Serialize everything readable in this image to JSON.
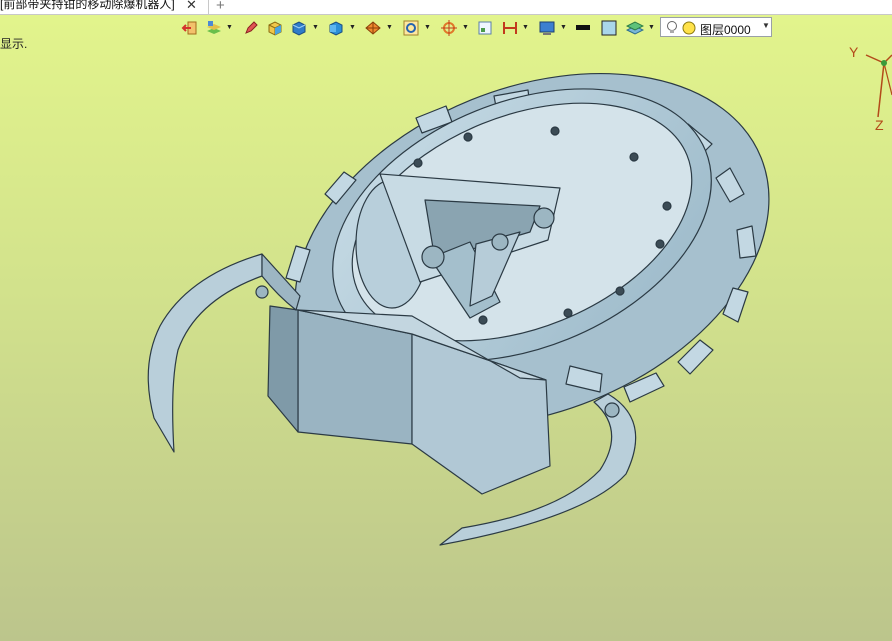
{
  "tab": {
    "title": "[前部带夹持钳的移动除爆机器人]",
    "close_glyph": "✕",
    "add_glyph": "+"
  },
  "hint": "显示.",
  "layer": {
    "value": "图层0000"
  },
  "axes": {
    "y": "Y",
    "z": "Z"
  },
  "toolbar": {
    "icons": [
      "exit-icon",
      "layers-stack-icon",
      "pencil-icon",
      "box-color-icon",
      "cube-shaded-icon",
      "cube-view-icon",
      "view-orientation-icon",
      "zoom-icon",
      "target-icon",
      "small-window-icon",
      "dimension-icon",
      "display-icon",
      "line-color-icon",
      "fill-color-icon",
      "layer-stack-icon",
      "lightbulb-icon",
      "layer-state-icon"
    ]
  },
  "colors": {
    "background_top": "#e3f58c",
    "background_bottom": "#bcc58c",
    "model_face": "#a9c3d1",
    "model_edge": "#2b3a44"
  }
}
